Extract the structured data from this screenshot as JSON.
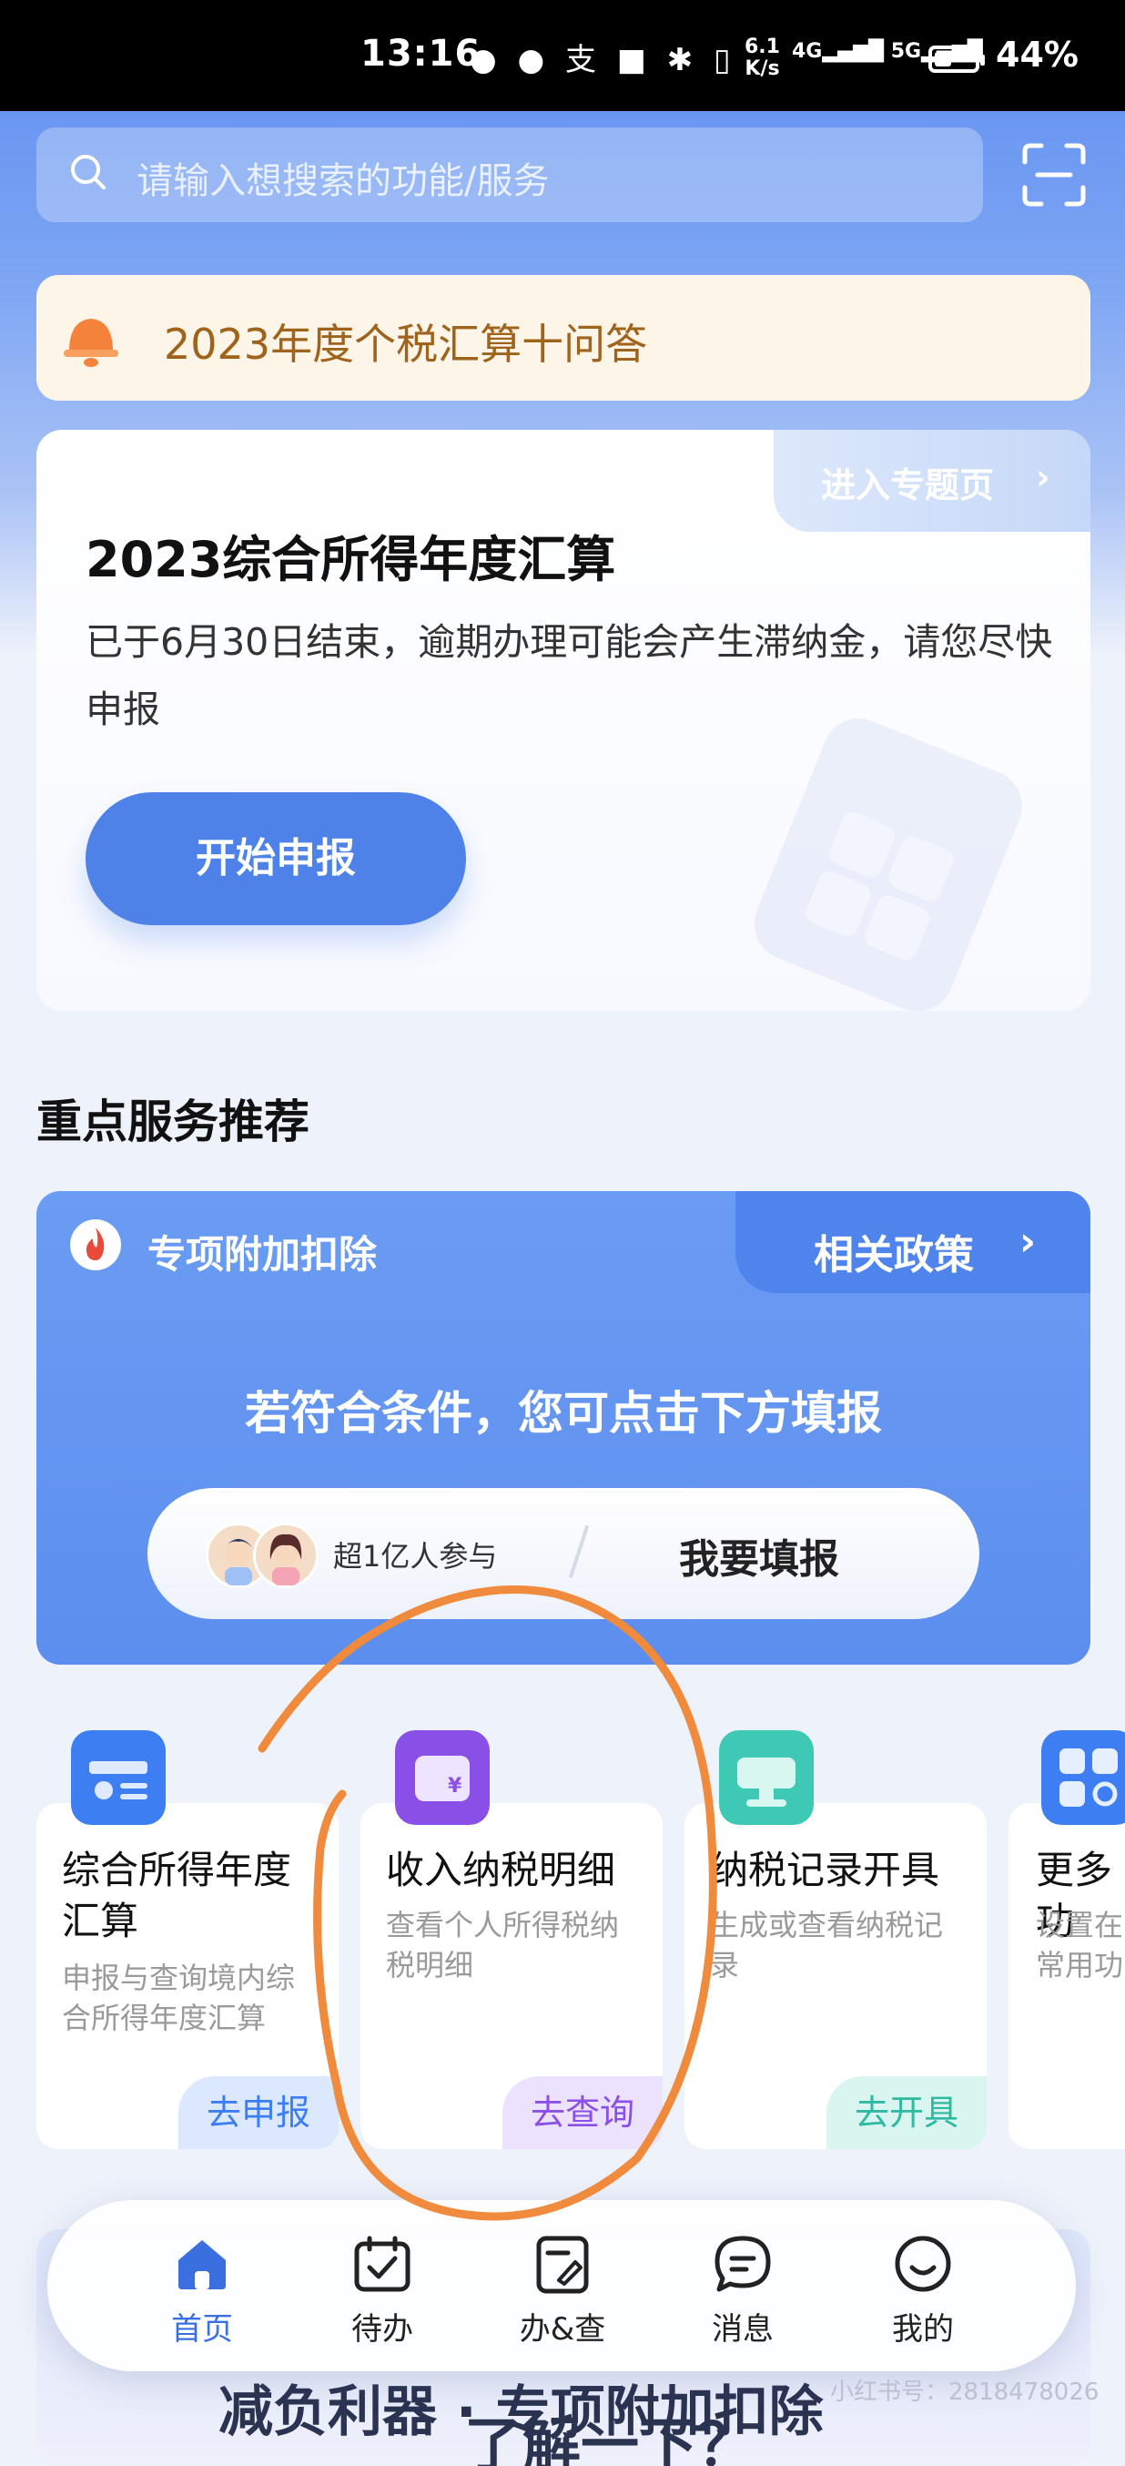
{
  "status_bar": {
    "time": "13:16",
    "net_speed_value": "6.1",
    "net_speed_unit": "K/s",
    "signal": "4G 5G",
    "battery_level": 0.44,
    "battery_text": "44%"
  },
  "search": {
    "placeholder": "请输入想搜索的功能/服务"
  },
  "notice": {
    "text": "2023年度个税汇算十问答"
  },
  "annual_card": {
    "topic_link": "进入专题页",
    "title": "2023综合所得年度汇算",
    "description": "已于6月30日结束，逾期办理可能会产生滞纳金，请您尽快申报",
    "button": "开始申报"
  },
  "section": {
    "title": "重点服务推荐"
  },
  "deduction_card": {
    "title": "专项附加扣除",
    "policy_link": "相关政策",
    "prompt": "若符合条件，您可点击下方填报",
    "participants": "超1亿人参与",
    "fill_button": "我要填报"
  },
  "services": [
    {
      "title_line1": "综合所得年度",
      "title_line2": "汇算",
      "desc_line1": "申报与查询境内综",
      "desc_line2": "合所得年度汇算",
      "action": "去申报"
    },
    {
      "title_line1": "收入纳税明细",
      "desc_line1": "查看个人所得税纳",
      "desc_line2": "税明细",
      "action": "去查询"
    },
    {
      "title_line1": "纳税记录开具",
      "desc_line1": "生成或查看纳税记",
      "desc_line2": "录",
      "action": "去开具"
    },
    {
      "title_line1": "更多功",
      "desc_line1": "设置在",
      "desc_line2": "常用功"
    }
  ],
  "bottom_peek": {
    "line1": "减负利器 · 专项附加扣除",
    "line2": "了解一下？"
  },
  "nav": [
    {
      "label": "首页",
      "icon": "home-icon",
      "active": true
    },
    {
      "label": "待办",
      "icon": "calendar-check-icon"
    },
    {
      "label": "办&查",
      "icon": "document-edit-icon"
    },
    {
      "label": "消息",
      "icon": "message-icon"
    },
    {
      "label": "我的",
      "icon": "smile-icon"
    }
  ],
  "watermark": "小红书号：2818478026",
  "colors": {
    "primary": "#4f82e8",
    "notice_text": "#a0631c",
    "annotation": "#f08a3c"
  }
}
